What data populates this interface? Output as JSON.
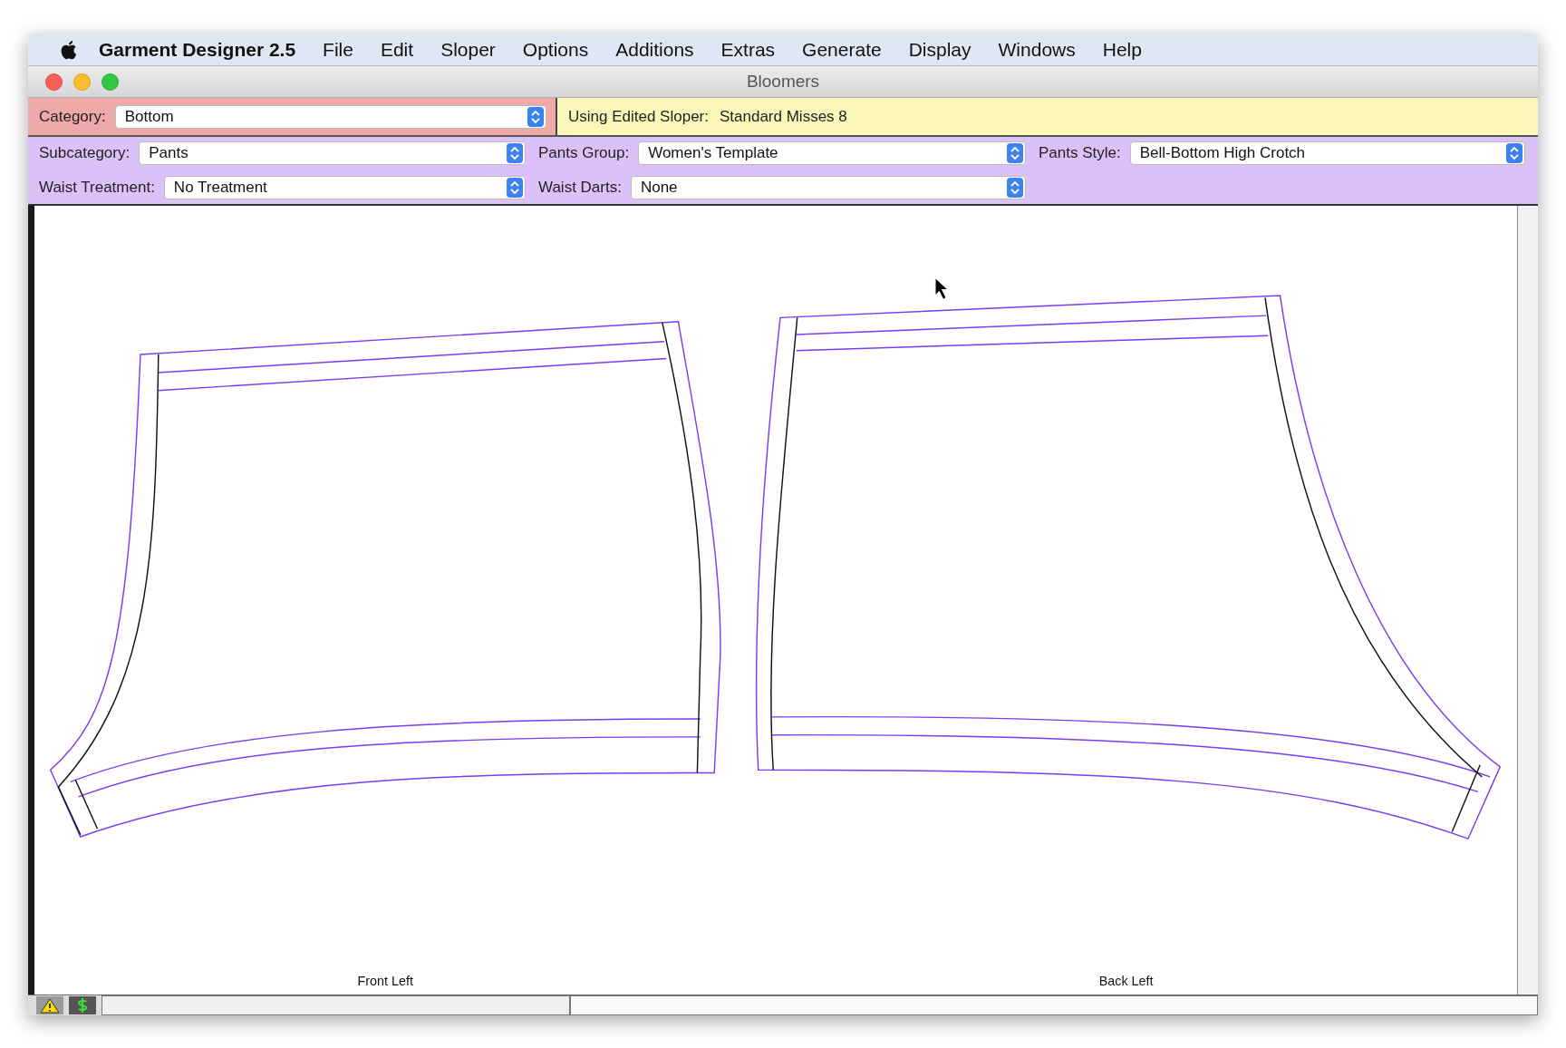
{
  "menu_bar": {
    "app_name": "Garment Designer 2.5",
    "menus": [
      "File",
      "Edit",
      "Sloper",
      "Options",
      "Additions",
      "Extras",
      "Generate",
      "Display",
      "Windows",
      "Help"
    ]
  },
  "window": {
    "title": "Bloomers"
  },
  "category": {
    "label": "Category:",
    "value": "Bottom"
  },
  "sloper": {
    "label": "Using Edited Sloper:",
    "value": "Standard Misses 8"
  },
  "option_rows": [
    [
      {
        "label": "Subcategory:",
        "value": "Pants"
      },
      {
        "label": "Pants Group:",
        "value": "Women's Template"
      },
      {
        "label": "Pants Style:",
        "value": "Bell-Bottom High Crotch"
      }
    ],
    [
      {
        "label": "Waist Treatment:",
        "value": "No Treatment"
      },
      {
        "label": "Waist Darts:",
        "value": "None"
      }
    ]
  ],
  "canvas": {
    "pieces": [
      {
        "label": "Front Left"
      },
      {
        "label": "Back Left"
      }
    ]
  }
}
